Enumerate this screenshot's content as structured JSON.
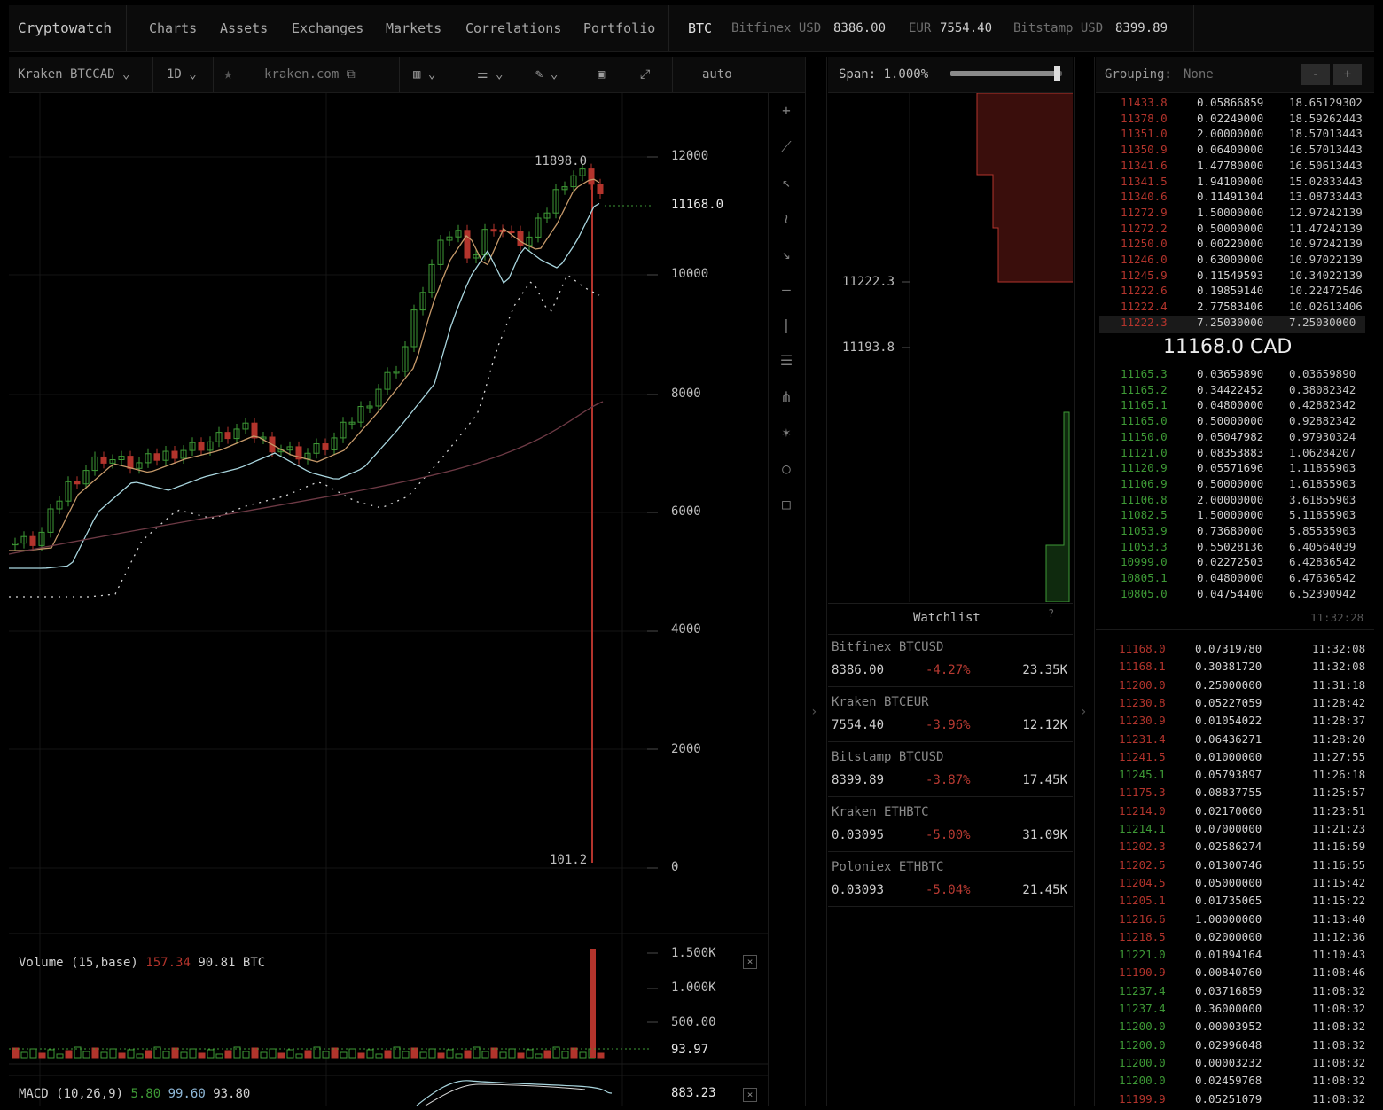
{
  "topnav": {
    "brand": "Cryptowatch",
    "links": [
      "Charts",
      "Assets",
      "Exchanges",
      "Markets",
      "Correlations",
      "Portfolio"
    ],
    "asset": "BTC",
    "tickers": [
      {
        "label": "Bitfinex USD",
        "value": "8386.00"
      },
      {
        "label": "EUR",
        "value": "7554.40"
      },
      {
        "label": "Bitstamp USD",
        "value": "8399.89"
      }
    ]
  },
  "chart_toolbar": {
    "market": "Kraken BTCCAD",
    "interval": "1D",
    "exchange_link": "kraken.com",
    "scale": "auto"
  },
  "price_axis": {
    "labels": [
      "12000",
      "10000",
      "8000",
      "6000",
      "4000",
      "2000",
      "0"
    ],
    "last_price": "11168.0",
    "high_label": "11898.0",
    "low_label": "101.2"
  },
  "volume": {
    "title": "Volume (15,base)",
    "value_red": "157.34",
    "value_base": "90.81 BTC",
    "axis": [
      "1.500K",
      "1.000K",
      "500.00"
    ],
    "current": "93.97"
  },
  "macd": {
    "title": "MACD (10,26,9)",
    "v1": "5.80",
    "v2": "99.60",
    "v3": "93.80",
    "current": "883.23"
  },
  "depth": {
    "span_label": "Span: 1.000%",
    "span_fraction": 0.95,
    "price_labels": [
      "11222.3",
      "11193.8"
    ]
  },
  "watchlist": {
    "title": "Watchlist",
    "help": "?",
    "items": [
      {
        "name": "Bitfinex BTCUSD",
        "price": "8386.00",
        "change": "-4.27%",
        "volume": "23.35K"
      },
      {
        "name": "Kraken BTCEUR",
        "price": "7554.40",
        "change": "-3.96%",
        "volume": "12.12K"
      },
      {
        "name": "Bitstamp BTCUSD",
        "price": "8399.89",
        "change": "-3.87%",
        "volume": "17.45K"
      },
      {
        "name": "Kraken ETHBTC",
        "price": "0.03095",
        "change": "-5.00%",
        "volume": "31.09K"
      },
      {
        "name": "Poloniex ETHBTC",
        "price": "0.03093",
        "change": "-5.04%",
        "volume": "21.45K"
      }
    ]
  },
  "orderbook": {
    "grouping_label": "Grouping:",
    "grouping_value": "None",
    "mid_price": "11168.0 CAD",
    "asks": [
      [
        "11433.8",
        "0.05866859",
        "18.65129302"
      ],
      [
        "11378.0",
        "0.02249000",
        "18.59262443"
      ],
      [
        "11351.0",
        "2.00000000",
        "18.57013443"
      ],
      [
        "11350.9",
        "0.06400000",
        "16.57013443"
      ],
      [
        "11341.6",
        "1.47780000",
        "16.50613443"
      ],
      [
        "11341.5",
        "1.94100000",
        "15.02833443"
      ],
      [
        "11340.6",
        "0.11491304",
        "13.08733443"
      ],
      [
        "11272.9",
        "1.50000000",
        "12.97242139"
      ],
      [
        "11272.2",
        "0.50000000",
        "11.47242139"
      ],
      [
        "11250.0",
        "0.00220000",
        "10.97242139"
      ],
      [
        "11246.0",
        "0.63000000",
        "10.97022139"
      ],
      [
        "11245.9",
        "0.11549593",
        "10.34022139"
      ],
      [
        "11222.6",
        "0.19859140",
        "10.22472546"
      ],
      [
        "11222.4",
        "2.77583406",
        "10.02613406"
      ],
      [
        "11222.3",
        "7.25030000",
        "7.25030000"
      ]
    ],
    "bids": [
      [
        "11165.3",
        "0.03659890",
        "0.03659890"
      ],
      [
        "11165.2",
        "0.34422452",
        "0.38082342"
      ],
      [
        "11165.1",
        "0.04800000",
        "0.42882342"
      ],
      [
        "11165.0",
        "0.50000000",
        "0.92882342"
      ],
      [
        "11150.0",
        "0.05047982",
        "0.97930324"
      ],
      [
        "11121.0",
        "0.08353883",
        "1.06284207"
      ],
      [
        "11120.9",
        "0.05571696",
        "1.11855903"
      ],
      [
        "11106.9",
        "0.50000000",
        "1.61855903"
      ],
      [
        "11106.8",
        "2.00000000",
        "3.61855903"
      ],
      [
        "11082.5",
        "1.50000000",
        "5.11855903"
      ],
      [
        "11053.9",
        "0.73680000",
        "5.85535903"
      ],
      [
        "11053.3",
        "0.55028136",
        "6.40564039"
      ],
      [
        "10999.0",
        "0.02272503",
        "6.42836542"
      ],
      [
        "10805.1",
        "0.04800000",
        "6.47636542"
      ],
      [
        "10805.0",
        "0.04754400",
        "6.52390942"
      ]
    ],
    "book_time": "11:32:28"
  },
  "trades": [
    [
      "11168.0",
      "0.07319780",
      "11:32:08",
      "s"
    ],
    [
      "11168.1",
      "0.30381720",
      "11:32:08",
      "s"
    ],
    [
      "11200.0",
      "0.25000000",
      "11:31:18",
      "s"
    ],
    [
      "11230.8",
      "0.05227059",
      "11:28:42",
      "s"
    ],
    [
      "11230.9",
      "0.01054022",
      "11:28:37",
      "s"
    ],
    [
      "11231.4",
      "0.06436271",
      "11:28:20",
      "s"
    ],
    [
      "11241.5",
      "0.01000000",
      "11:27:55",
      "s"
    ],
    [
      "11245.1",
      "0.05793897",
      "11:26:18",
      "b"
    ],
    [
      "11175.3",
      "0.08837755",
      "11:25:57",
      "s"
    ],
    [
      "11214.0",
      "0.02170000",
      "11:23:51",
      "s"
    ],
    [
      "11214.1",
      "0.07000000",
      "11:21:23",
      "b"
    ],
    [
      "11202.3",
      "0.02586274",
      "11:16:59",
      "s"
    ],
    [
      "11202.5",
      "0.01300746",
      "11:16:55",
      "s"
    ],
    [
      "11204.5",
      "0.05000000",
      "11:15:42",
      "s"
    ],
    [
      "11205.1",
      "0.01735065",
      "11:15:22",
      "s"
    ],
    [
      "11216.6",
      "1.00000000",
      "11:13:40",
      "s"
    ],
    [
      "11218.5",
      "0.02000000",
      "11:12:36",
      "s"
    ],
    [
      "11221.0",
      "0.01894164",
      "11:10:43",
      "b"
    ],
    [
      "11190.9",
      "0.00840760",
      "11:08:46",
      "s"
    ],
    [
      "11237.4",
      "0.03716859",
      "11:08:32",
      "b"
    ],
    [
      "11237.4",
      "0.36000000",
      "11:08:32",
      "b"
    ],
    [
      "11200.0",
      "0.00003952",
      "11:08:32",
      "b"
    ],
    [
      "11200.0",
      "0.02996048",
      "11:08:32",
      "b"
    ],
    [
      "11200.0",
      "0.00003232",
      "11:08:32",
      "b"
    ],
    [
      "11200.0",
      "0.02459768",
      "11:08:32",
      "b"
    ],
    [
      "11199.9",
      "0.05251079",
      "11:08:32",
      "s"
    ]
  ],
  "colors": {
    "up": "#3e9a36",
    "down": "#b3342c",
    "bg": "#000000",
    "panel": "#0b0b0b"
  }
}
